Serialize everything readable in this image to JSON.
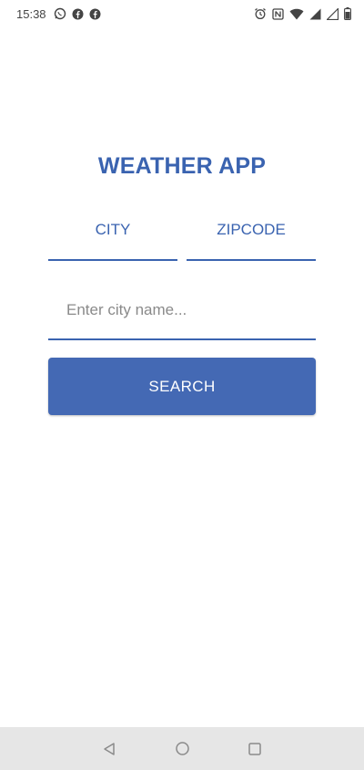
{
  "status_bar": {
    "time": "15:38",
    "left_icons": [
      "whatsapp-icon",
      "facebook-icon",
      "facebook-icon"
    ],
    "right_icons": [
      "alarm-icon",
      "nfc-icon",
      "wifi-icon",
      "signal-icon",
      "signal-icon",
      "battery-icon"
    ]
  },
  "app": {
    "title": "WEATHER APP"
  },
  "tabs": [
    {
      "label": "CITY"
    },
    {
      "label": "ZIPCODE"
    }
  ],
  "search": {
    "placeholder": "Enter city name...",
    "value": ""
  },
  "button": {
    "label": "SEARCH"
  },
  "nav_bar": {
    "buttons": [
      "back-icon",
      "home-icon",
      "recents-icon"
    ]
  },
  "colors": {
    "accent": "#3a63b0",
    "button": "#4469b4",
    "nav_bar": "#e6e6e6"
  }
}
